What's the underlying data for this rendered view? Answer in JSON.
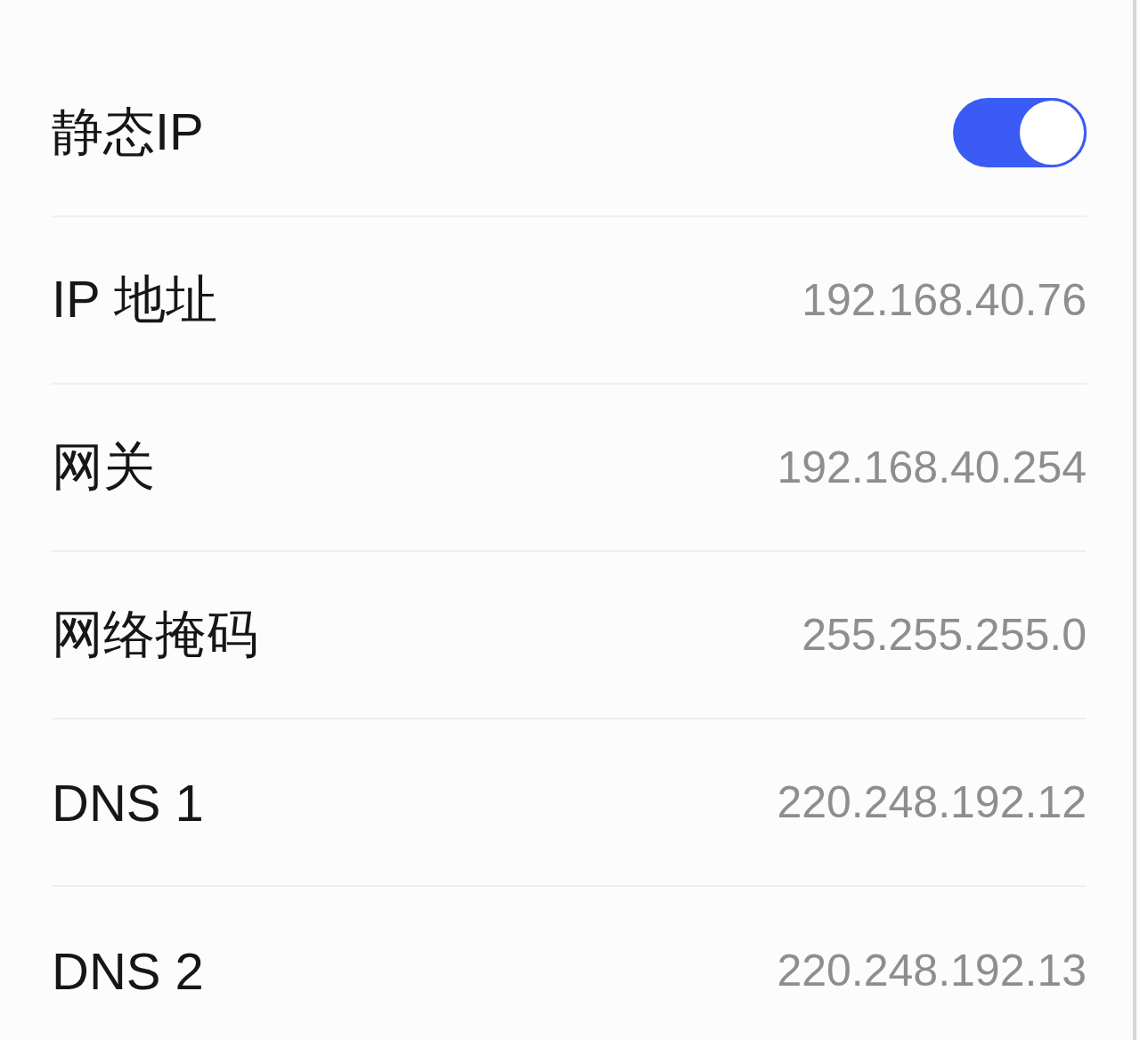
{
  "rows": [
    {
      "kind": "toggle",
      "label": "静态IP",
      "on": true
    },
    {
      "kind": "value",
      "label": "IP 地址",
      "value": "192.168.40.76"
    },
    {
      "kind": "value",
      "label": "网关",
      "value": "192.168.40.254"
    },
    {
      "kind": "value",
      "label": "网络掩码",
      "value": "255.255.255.0"
    },
    {
      "kind": "value",
      "label": "DNS 1",
      "value": "220.248.192.12"
    },
    {
      "kind": "value",
      "label": "DNS 2",
      "value": "220.248.192.13"
    }
  ]
}
